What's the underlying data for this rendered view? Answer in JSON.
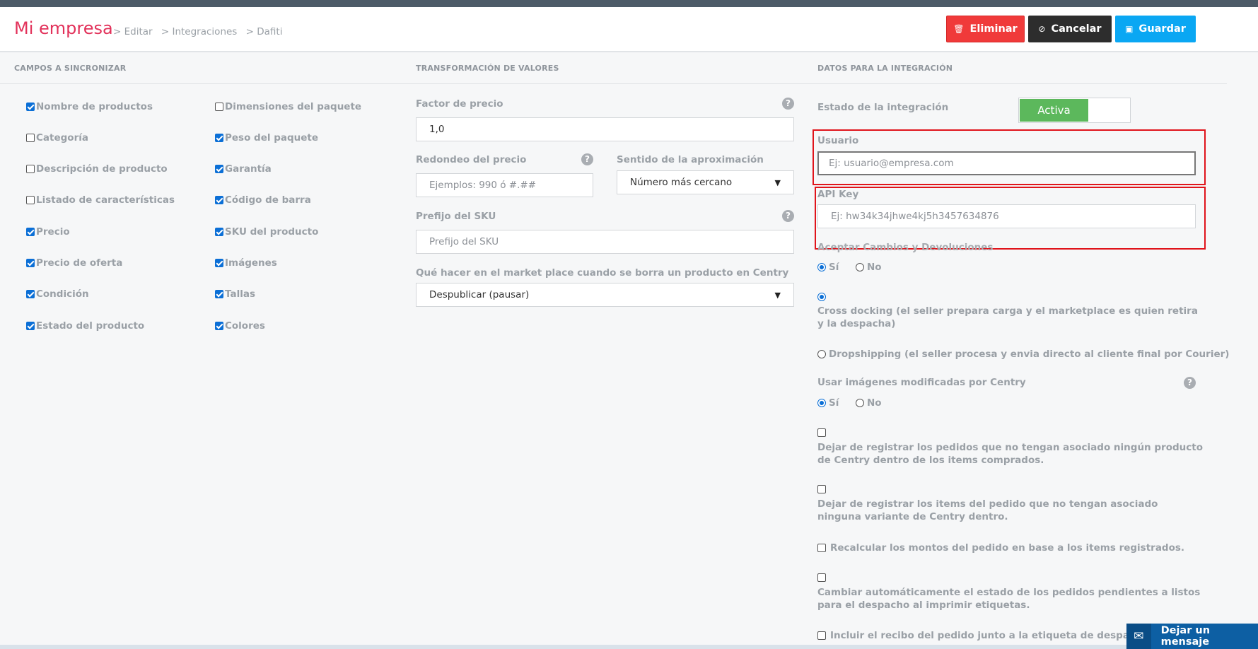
{
  "header": {
    "title": "Mi empresa",
    "breadcrumbs": [
      "> Editar",
      "> Integraciones",
      "> Dafiti"
    ],
    "buttons": {
      "delete": {
        "label": "Eliminar",
        "icon": "trash-icon",
        "color": "#f03a3a"
      },
      "cancel": {
        "label": "Cancelar",
        "icon": "ban-icon",
        "color": "#2d2d2d"
      },
      "save": {
        "label": "Guardar",
        "icon": "floppy-icon",
        "color": "#0aa7f3"
      }
    }
  },
  "sections": {
    "fields": "CAMPOS A SINCRONIZAR",
    "transform": "TRANSFORMACIÓN DE VALORES",
    "integration": "DATOS PARA LA INTEGRACIÓN"
  },
  "sync_fields": {
    "col1": [
      {
        "label": "Nombre de productos",
        "checked": true
      },
      {
        "label": "Categoría",
        "checked": false
      },
      {
        "label": "Descripción de producto",
        "checked": false
      },
      {
        "label": "Listado de características",
        "checked": false
      },
      {
        "label": "Precio",
        "checked": true
      },
      {
        "label": "Precio de oferta",
        "checked": true
      },
      {
        "label": "Condición",
        "checked": true
      },
      {
        "label": "Estado del producto",
        "checked": true
      }
    ],
    "col2": [
      {
        "label": "Dimensiones del paquete",
        "checked": false
      },
      {
        "label": "Peso del paquete",
        "checked": true
      },
      {
        "label": "Garantía",
        "checked": true
      },
      {
        "label": "Código de barra",
        "checked": true
      },
      {
        "label": "SKU del producto",
        "checked": true
      },
      {
        "label": "Imágenes",
        "checked": true
      },
      {
        "label": "Tallas",
        "checked": true
      },
      {
        "label": "Colores",
        "checked": true
      }
    ]
  },
  "transform": {
    "price_factor": {
      "label": "Factor de precio",
      "value": "1,0"
    },
    "rounding": {
      "label": "Redondeo del precio",
      "placeholder": "Ejemplos: 990 ó #.##"
    },
    "approx": {
      "label": "Sentido de la aproximación",
      "value": "Número más cercano"
    },
    "sku_prefix": {
      "label": "Prefijo del SKU",
      "placeholder": "Prefijo del SKU"
    },
    "on_delete": {
      "label": "Qué hacer en el market place cuando se borra un producto en Centry",
      "value": "Despublicar (pausar)"
    }
  },
  "integration": {
    "status_label": "Estado de la integración",
    "status_value": "Activa",
    "status_color": "#5cb85c",
    "user": {
      "label": "Usuario",
      "placeholder": "Ej: usuario@empresa.com"
    },
    "api_key": {
      "label": "API Key",
      "placeholder": "Ej: hw34k34jhwe4kj5h3457634876"
    },
    "accept_changes": {
      "label": "Aceptar Cambios y Devoluciones",
      "yes": "Sí",
      "no": "No",
      "selected": "Sí"
    },
    "cross_docking": "Cross docking (el seller prepara carga y el marketplace es quien retira y la despacha)",
    "dropshipping": "Dropshipping (el seller procesa y envia directo al cliente final por Courier)",
    "modified_images": {
      "label": "Usar imágenes modificadas por Centry",
      "yes": "Sí",
      "no": "No",
      "selected": "Sí"
    },
    "opt1": "Dejar de registrar los pedidos que no tengan asociado ningún producto de Centry dentro de los items comprados.",
    "opt2": "Dejar de registrar los items del pedido que no tengan asociado ninguna variante de Centry dentro.",
    "opt3": "Recalcular los montos del pedido en base a los items registrados.",
    "opt4": "Cambiar automáticamente el estado de los pedidos pendientes a listos para el despacho al imprimir etiquetas.",
    "opt5": "Incluir el recibo del pedido junto a la etiqueta de despacho."
  },
  "chat": {
    "label": "Dejar un mensaje",
    "icon": "envelope-icon"
  }
}
